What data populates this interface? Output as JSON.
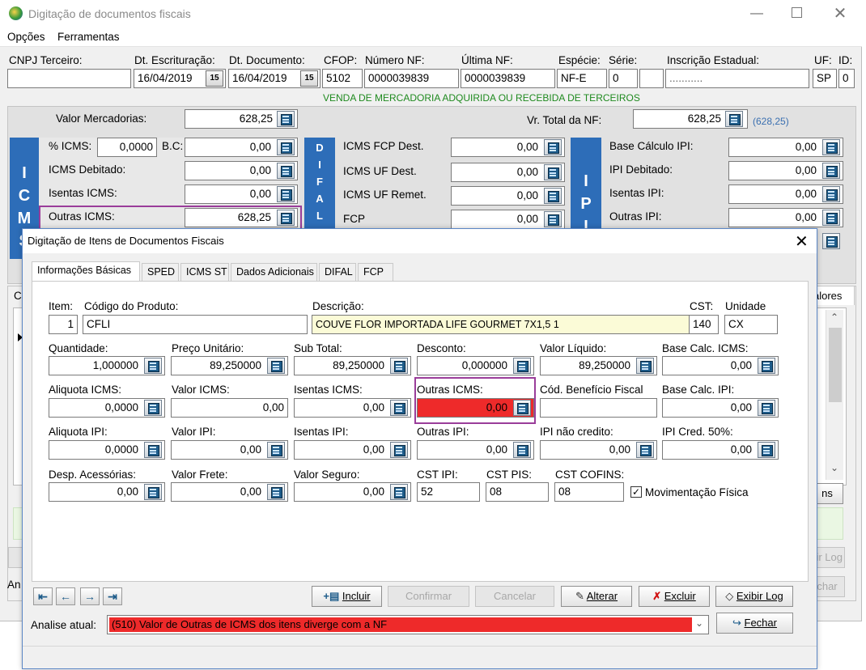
{
  "main_window": {
    "title": "Digitação de documentos fiscais",
    "menu": [
      "Opções",
      "Ferramentas"
    ],
    "header": {
      "cnpj_label": "CNPJ Terceiro:",
      "cnpj_value": "",
      "dt_escrit_label": "Dt. Escrituração:",
      "dt_escrit_value": "16/04/2019",
      "dt_doc_label": "Dt. Documento:",
      "dt_doc_value": "16/04/2019",
      "cfop_label": "CFOP:",
      "cfop_value": "5102",
      "num_nf_label": "Número NF:",
      "num_nf_value": "0000039839",
      "ultima_nf_label": "Última NF:",
      "ultima_nf_value": "0000039839",
      "especie_label": "Espécie:",
      "especie_value": "NF-E",
      "serie_label": "Série:",
      "serie_value": "0",
      "ie_label": "Inscrição Estadual:",
      "ie_value": "...........",
      "uf_label": "UF:",
      "uf_value": "SP",
      "id_label": "ID:",
      "id_value": "0",
      "cfop_description": "VENDA DE MERCADORIA ADQUIRIDA OU RECEBIDA DE TERCEIROS"
    },
    "valor_mercadorias_label": "Valor Mercadorias:",
    "valor_mercadorias_value": "628,25",
    "vr_total_nf_label": "Vr. Total da NF:",
    "vr_total_nf_value": "628,25",
    "vr_total_nf_hint": "(628,25)",
    "icms_panel_letters": [
      "I",
      "C",
      "M",
      "S"
    ],
    "difal_panel_letters": [
      "D",
      "I",
      "F",
      "A",
      "L"
    ],
    "ipi_panel_letters": [
      "I",
      "P",
      "I"
    ],
    "pct_icms_label": "% ICMS:",
    "pct_icms_value": "0,0000",
    "bc_label": "B.C:",
    "bc_value": "0,00",
    "icms_debitado_label": "ICMS Debitado:",
    "icms_debitado_value": "0,00",
    "isentas_icms_label": "Isentas ICMS:",
    "isentas_icms_value": "0,00",
    "outras_icms_label": "Outras ICMS:",
    "outras_icms_value": "628,25",
    "fcp_dest_label": "ICMS FCP Dest.",
    "fcp_dest_value": "0,00",
    "uf_dest_label": "ICMS UF Dest.",
    "uf_dest_value": "0,00",
    "uf_remet_label": "ICMS UF Remet.",
    "uf_remet_value": "0,00",
    "fcp_label": "FCP",
    "fcp_value": "0,00",
    "bc_ipi_label": "Base Cálculo IPI:",
    "bc_ipi_value": "0,00",
    "ipi_debitado_label": "IPI Debitado:",
    "ipi_debitado_value": "0,00",
    "isentas_ipi_label": "Isentas IPI:",
    "isentas_ipi_value": "0,00",
    "outras_ipi_label": "Outras IPI:",
    "outras_ipi_value": "0,00",
    "behind_tab_text": "alores",
    "behind_c": "C",
    "behind_an": "An",
    "behind_btn1": "ns",
    "behind_btn2": "ir Log",
    "behind_btn3": "char"
  },
  "dialog": {
    "title": "Digitação de Itens de Documentos Fiscais",
    "tabs": [
      "Informações Básicas",
      "SPED",
      "ICMS ST",
      "Dados Adicionais",
      "DIFAL",
      "FCP"
    ],
    "item_label": "Item:",
    "item_value": "1",
    "codigo_label": "Código do Produto:",
    "codigo_value": "CFLI",
    "descricao_label": "Descrição:",
    "descricao_value": "COUVE FLOR IMPORTADA LIFE GOURMET 7X1,5     1",
    "cst_label": "CST:",
    "cst_value": "140",
    "unidade_label": "Unidade",
    "unidade_value": "CX",
    "quantidade_label": "Quantidade:",
    "quantidade_value": "1,000000",
    "preco_label": "Preço Unitário:",
    "preco_value": "89,250000",
    "subtotal_label": "Sub Total:",
    "subtotal_value": "89,250000",
    "desconto_label": "Desconto:",
    "desconto_value": "0,000000",
    "valor_liquido_label": "Valor Líquido:",
    "valor_liquido_value": "89,250000",
    "bc_icms_label": "Base Calc. ICMS:",
    "bc_icms_value": "0,00",
    "aliq_icms_label": "Aliquota ICMS:",
    "aliq_icms_value": "0,0000",
    "valor_icms_label": "Valor ICMS:",
    "valor_icms_value": "0,00",
    "isentas_icms_label": "Isentas ICMS:",
    "isentas_icms_value": "0,00",
    "outras_icms_label": "Outras ICMS:",
    "outras_icms_value": "0,00",
    "cod_benef_label": "Cód. Benefício Fiscal",
    "cod_benef_value": "",
    "bc_ipi_label": "Base Calc. IPI:",
    "bc_ipi_value": "0,00",
    "aliq_ipi_label": "Aliquota IPI:",
    "aliq_ipi_value": "0,0000",
    "valor_ipi_label": "Valor IPI:",
    "valor_ipi_value": "0,00",
    "isentas_ipi_label": "Isentas IPI:",
    "isentas_ipi_value": "0,00",
    "outras_ipi_label": "Outras IPI:",
    "outras_ipi_value": "0,00",
    "ipi_nao_cred_label": "IPI não credito:",
    "ipi_nao_cred_value": "0,00",
    "ipi_cred_label": "IPI Cred. 50%:",
    "ipi_cred_value": "0,00",
    "desp_label": "Desp. Acessórias:",
    "desp_value": "0,00",
    "frete_label": "Valor Frete:",
    "frete_value": "0,00",
    "seguro_label": "Valor Seguro:",
    "seguro_value": "0,00",
    "cst_ipi_label": "CST IPI:",
    "cst_ipi_value": "52",
    "cst_pis_label": "CST PIS:",
    "cst_pis_value": "08",
    "cst_cofins_label": "CST COFINS:",
    "cst_cofins_value": "08",
    "mov_fisica_label": "Movimentação Física",
    "mov_fisica_checked": true,
    "buttons": {
      "incluir": "Incluir",
      "confirmar": "Confirmar",
      "cancelar": "Cancelar",
      "alterar": "Alterar",
      "excluir": "Excluir",
      "exibir_log": "Exibir Log",
      "fechar": "Fechar"
    },
    "analise_label": "Analise atual:",
    "analise_value": "(510) Valor de Outras de ICMS dos itens diverge com a NF"
  },
  "colors": {
    "icms_panel": "#2d6db8",
    "highlight_border": "#9a3d9a",
    "error_red": "#ee2a2a",
    "cfop_green": "#1f8a1f"
  }
}
